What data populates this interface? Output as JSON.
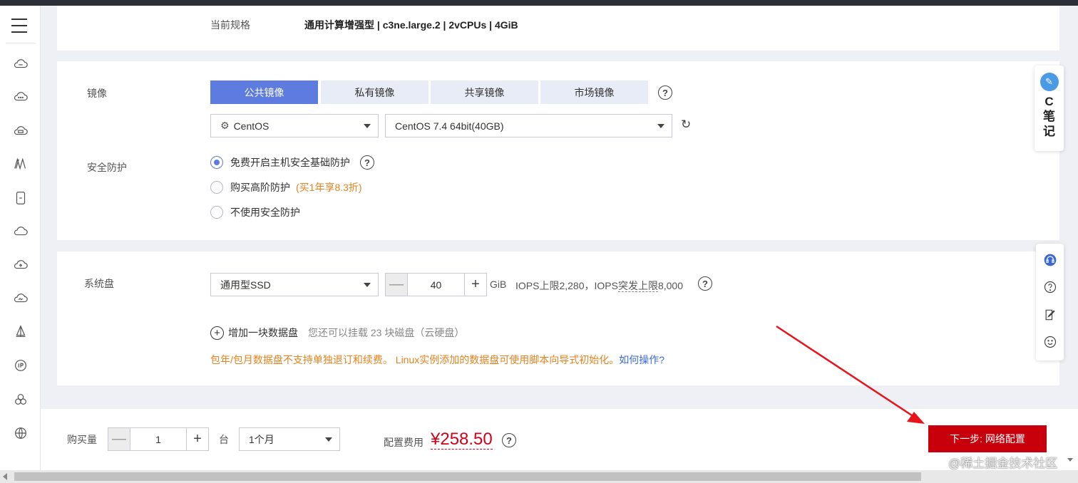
{
  "spec": {
    "label": "当前规格",
    "value": "通用计算增强型 | c3ne.large.2 | 2vCPUs | 4GiB"
  },
  "image": {
    "label": "镜像",
    "tabs": [
      "公共镜像",
      "私有镜像",
      "共享镜像",
      "市场镜像"
    ],
    "active_tab": "公共镜像",
    "os_select": "CentOS",
    "version_select": "CentOS 7.4 64bit(40GB)"
  },
  "security": {
    "label": "安全防护",
    "options": [
      "免费开启主机安全基础防护",
      "购买高阶防护",
      "不使用安全防护"
    ],
    "selected": "免费开启主机安全基础防护",
    "promo": "(买1年享8.3折)"
  },
  "disk": {
    "label": "系统盘",
    "type_select": "通用型SSD",
    "size": "40",
    "unit": "GiB",
    "iops_prefix": "IOPS上限2,280，IOPS",
    "iops_dotted": "突发上限",
    "iops_suffix": "8,000",
    "add_label": "增加一块数据盘",
    "add_hint": "您还可以挂载 23 块磁盘（云硬盘）",
    "warning": "包年/包月数据盘不支持单独退订和续费。 Linux实例添加的数据盘可使用脚本向导式初始化。",
    "warning_link": "如何操作?"
  },
  "purchase": {
    "qty_label": "购买量",
    "qty": "1",
    "qty_unit": "台",
    "duration": "1个月",
    "fee_label": "配置费用",
    "price": "¥258.50",
    "next_button": "下一步: 网络配置"
  },
  "side_note": {
    "logo_text": "✎",
    "label": "C笔记"
  },
  "watermark": "@稀土掘金技术社区",
  "colors": {
    "accent": "#5e7ce0",
    "primary_button": "#c7000b",
    "price": "#d0021b",
    "warning": "#e6821e",
    "annotation_arrow": "#e8141c"
  }
}
